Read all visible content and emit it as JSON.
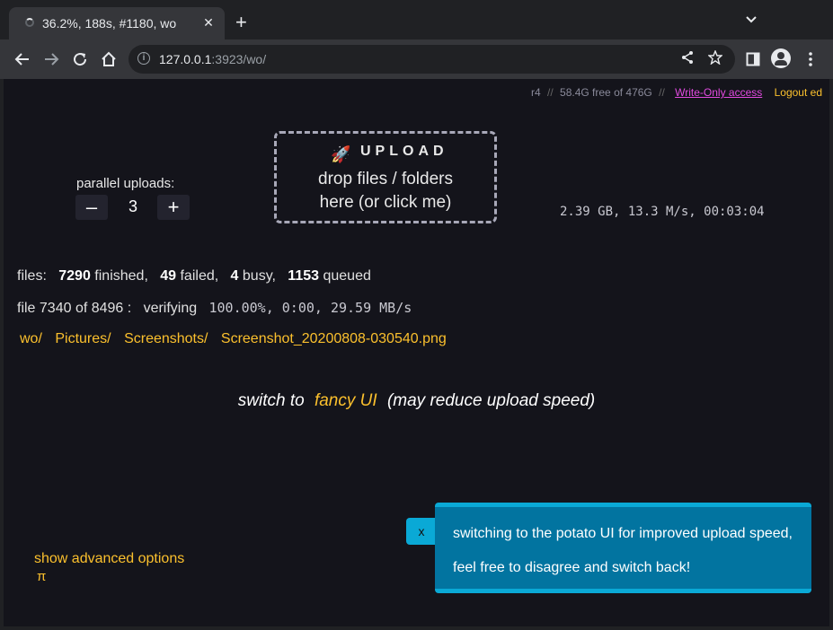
{
  "browser": {
    "tab_title": "36.2%, 188s, #1180, wo",
    "tab_close": "✕",
    "new_tab": "+",
    "tab_menu": "⌄",
    "url_host": "127.0.0.1",
    "url_rest": ":3923/wo/",
    "icons": [
      "back-icon",
      "forward-icon",
      "reload-icon",
      "home-icon",
      "info-icon",
      "share-icon",
      "star-icon",
      "sidebar-icon",
      "avatar-icon",
      "menu-icon"
    ]
  },
  "server_info": {
    "version": "r4",
    "sep": "//",
    "disk": "58.4G free of 476G",
    "access": "Write-Only access",
    "logout": "Logout ed"
  },
  "upload": {
    "parallel_label": "parallel uploads:",
    "minus": "–",
    "plus": "+",
    "parallel_value": "3",
    "title": "UPLOAD",
    "hint_line1": "drop files / folders",
    "hint_line2": "here (or click me)",
    "stats": "2.39 GB, 13.3 M/s, 00:03:04"
  },
  "files": {
    "label": "files:",
    "finished_count": "7290",
    "finished_label": "finished,",
    "failed_count": "49",
    "failed_label": "failed,",
    "busy_count": "4",
    "busy_label": "busy,",
    "queued_count": "1153",
    "queued_label": "queued"
  },
  "current_file": {
    "label": "file 7340 of 8496 :",
    "status": "verifying",
    "progress": "100.00%, 0:00, 29.59 MB/s"
  },
  "breadcrumbs": [
    "wo/",
    "Pictures/",
    "Screenshots/",
    "Screenshot_20200808-030540.png"
  ],
  "switch_ui": {
    "prefix": "switch to",
    "link": "fancy UI",
    "suffix": "(may reduce upload speed)"
  },
  "advanced": {
    "label": "show advanced options",
    "pi": "π"
  },
  "toast": {
    "close": "x",
    "line1": "switching to the potato UI for improved upload speed,",
    "line2": "feel free to disagree and switch back!"
  },
  "colors": {
    "accent": "#fbc02d",
    "access": "#e24ae0",
    "toast_bg": "#0274a0",
    "toast_border": "#0aa9d6",
    "page_bg": "#14141b"
  }
}
